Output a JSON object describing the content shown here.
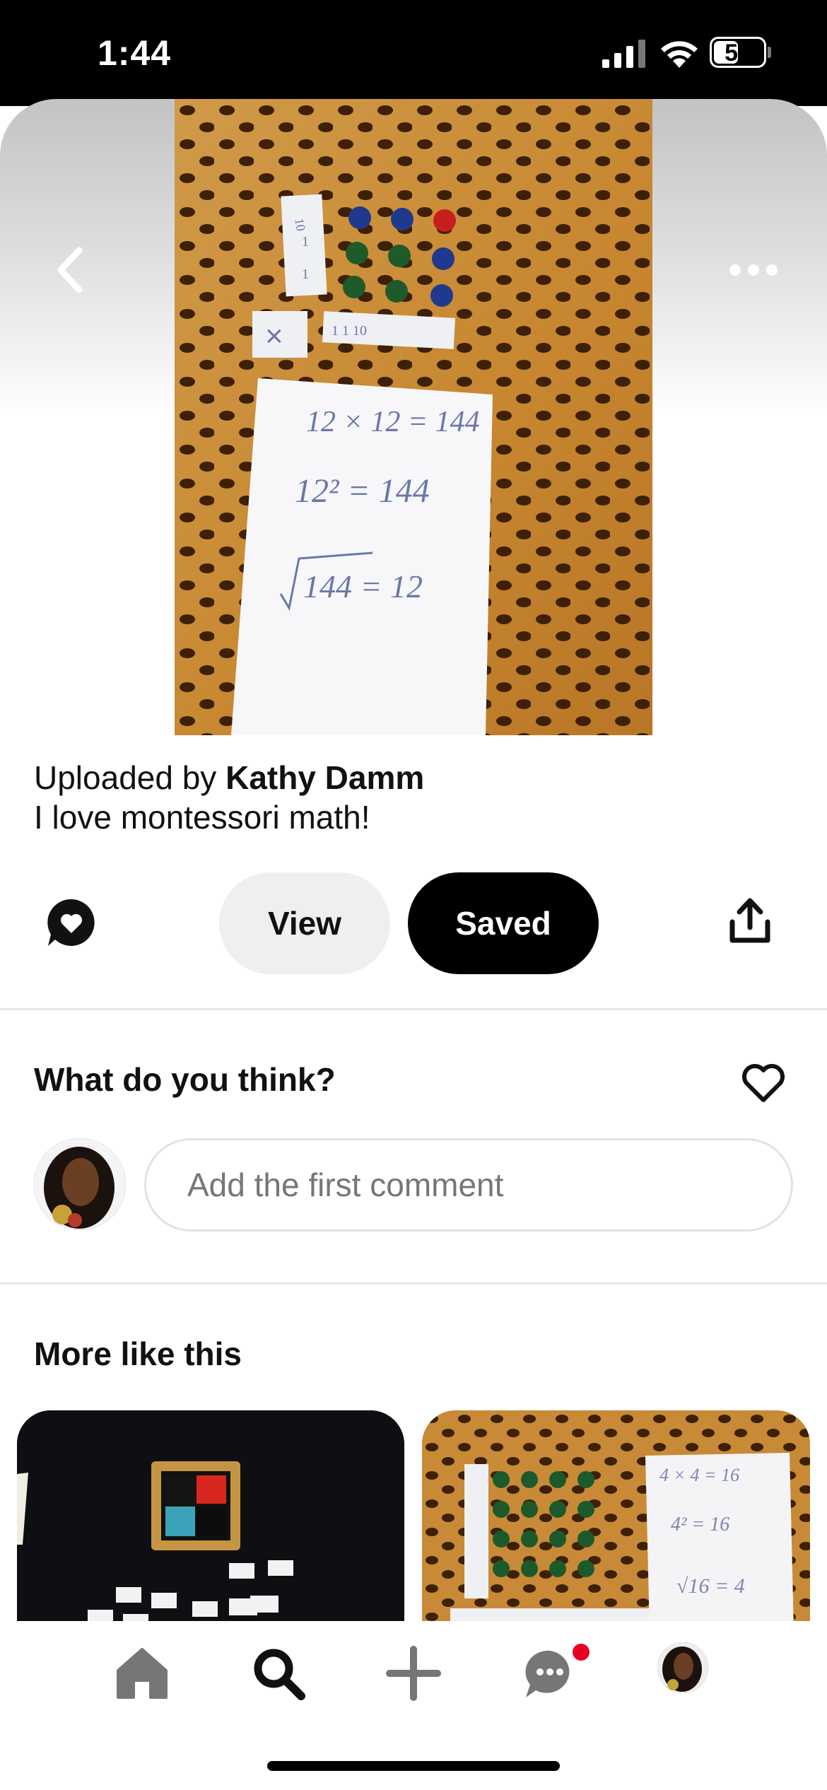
{
  "status_bar": {
    "time": "1:44",
    "battery_level": "50",
    "battery_fraction": 0.5
  },
  "pin": {
    "image_icon": "montessori-checkerboard-photo",
    "uploaded_prefix": "Uploaded by ",
    "uploader": "Kathy Damm",
    "description": "I love montessori math!"
  },
  "actions": {
    "view_label": "View",
    "saved_label": "Saved"
  },
  "comments": {
    "title": "What do you think?",
    "placeholder": "Add the first comment"
  },
  "more": {
    "title": "More like this"
  },
  "tabs": [
    {
      "name": "home-tab",
      "icon": "home-icon"
    },
    {
      "name": "search-tab",
      "icon": "search-icon",
      "selected": true
    },
    {
      "name": "create-tab",
      "icon": "plus-icon"
    },
    {
      "name": "messages-tab",
      "icon": "chat-bubble-icon",
      "badge": true
    },
    {
      "name": "profile-tab",
      "icon": "avatar"
    }
  ],
  "colors": {
    "accent": "#000000",
    "badge": "#e60023",
    "view_button_bg": "#efefef"
  }
}
